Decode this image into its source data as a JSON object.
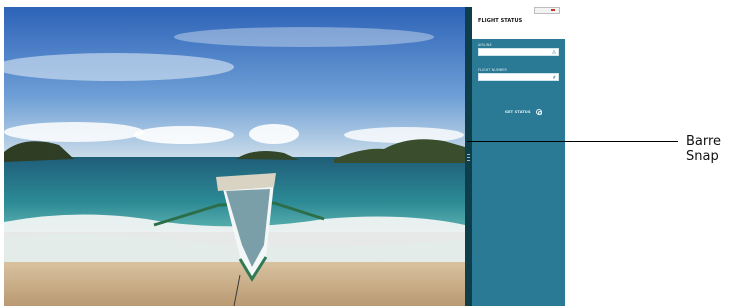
{
  "app": {
    "title": "FLIGHT STATUS",
    "fields": [
      {
        "label": "AIRLINE",
        "value": "",
        "icon": "airline-icon"
      },
      {
        "label": "FLIGHT NUMBER",
        "value": "",
        "icon": "hash-icon"
      }
    ],
    "get_status_label": "GET STATUS"
  },
  "callout": {
    "label": "Barre Snap"
  },
  "colors": {
    "panel": "#2a7a96",
    "snap_bar": "#0e3e4a",
    "frame": "#1d1d1d"
  }
}
